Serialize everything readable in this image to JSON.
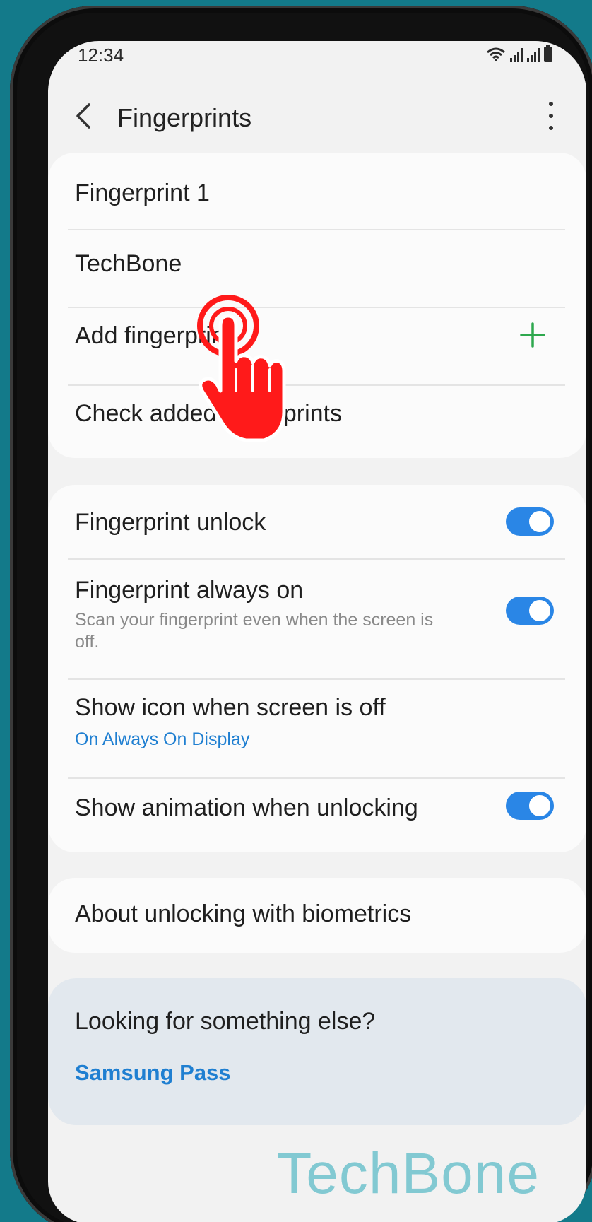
{
  "status_bar": {
    "time": "12:34"
  },
  "app_bar": {
    "title": "Fingerprints"
  },
  "fingerprint_list": {
    "items": [
      {
        "label": "Fingerprint 1"
      },
      {
        "label": "TechBone"
      }
    ],
    "add_label": "Add fingerprint",
    "check_label": "Check added fingerprints"
  },
  "settings": {
    "unlock": {
      "label": "Fingerprint unlock",
      "enabled": true
    },
    "always_on": {
      "label": "Fingerprint always on",
      "description": "Scan your fingerprint even when the screen is off.",
      "enabled": true
    },
    "show_icon": {
      "label": "Show icon when screen is off",
      "value": "On Always On Display"
    },
    "animation": {
      "label": "Show animation when unlocking",
      "enabled": true
    }
  },
  "about": {
    "label": "About unlocking with biometrics"
  },
  "suggestions": {
    "question": "Looking for something else?",
    "link": "Samsung Pass"
  },
  "watermark": "TechBone",
  "colors": {
    "accent": "#2a86e6",
    "link": "#1f7fd1",
    "add_icon": "#2ea84e",
    "tap_hand": "#ff1a1a",
    "background": "#137a8a"
  },
  "icons": [
    "back-arrow-icon",
    "more-options-icon",
    "wifi-icon",
    "signal-icon",
    "battery-icon",
    "plus-icon",
    "tap-hand-icon"
  ]
}
